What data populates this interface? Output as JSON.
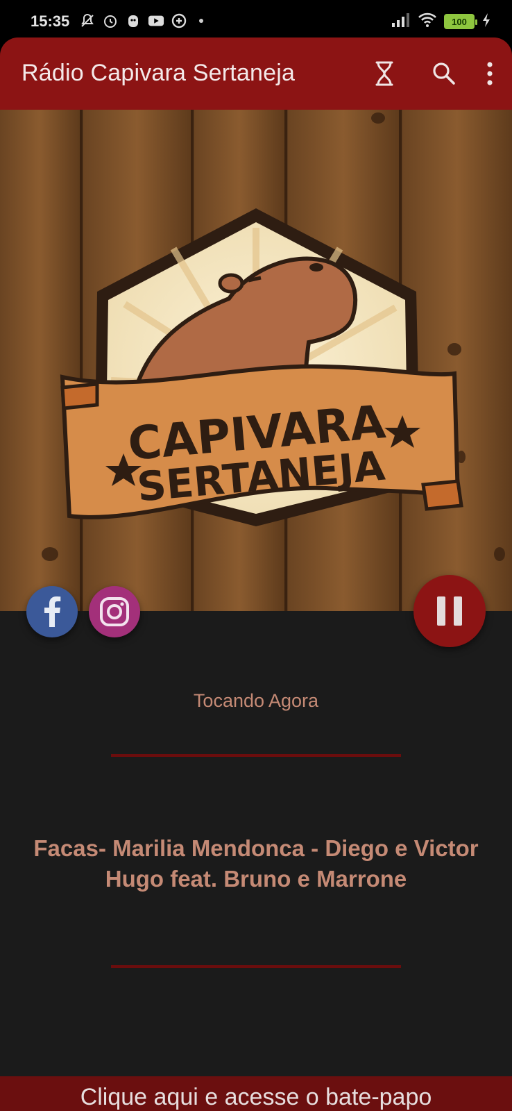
{
  "status_bar": {
    "time": "15:35",
    "battery": "100",
    "icons_left": [
      "mute-icon",
      "alarm-icon",
      "app-icon",
      "youtube-icon",
      "data-saver-icon"
    ],
    "icons_right": [
      "signal-icon",
      "wifi-icon",
      "battery-icon",
      "charging-icon"
    ]
  },
  "app_bar": {
    "title": "Rádio Capivara Sertaneja",
    "actions": [
      "hourglass-icon",
      "search-icon",
      "more-vert-icon"
    ],
    "color": "#8c1414"
  },
  "hero": {
    "logo_line1": "CAPIVARA",
    "logo_line2": "SERTANEJA"
  },
  "social": {
    "facebook_color": "#3b5999",
    "instagram_color": "#a3307a"
  },
  "player": {
    "now_playing_label": "Tocando Agora",
    "track": "Facas- Marilia Mendonca - Diego e Victor Hugo feat. Bruno e Marrone",
    "state_icon": "pause-icon"
  },
  "chat": {
    "label": "Clique aqui e acesse o bate-papo"
  }
}
